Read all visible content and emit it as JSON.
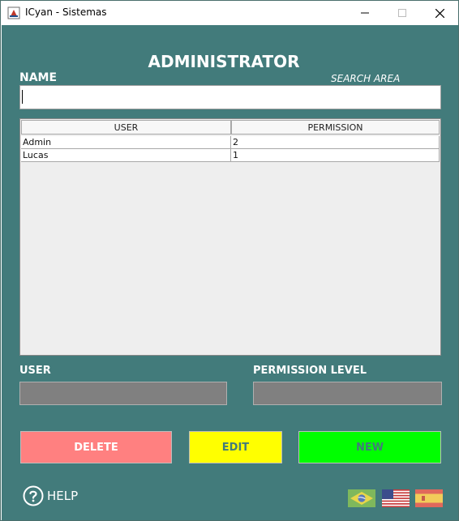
{
  "window": {
    "title": "ICyan - Sistemas"
  },
  "header": {
    "title": "ADMINISTRATOR",
    "name_label": "NAME",
    "search_hint": "SEARCH AREA"
  },
  "search": {
    "value": "",
    "placeholder": ""
  },
  "table": {
    "columns": [
      "USER",
      "PERMISSION"
    ],
    "rows": [
      [
        "Admin",
        "2"
      ],
      [
        "Lucas",
        "1"
      ]
    ]
  },
  "form": {
    "user_label": "USER",
    "permission_label": "PERMISSION LEVEL"
  },
  "buttons": {
    "delete": "DELETE",
    "edit": "EDIT",
    "new": "NEW"
  },
  "footer": {
    "help_label": "HELP",
    "flags": [
      "brazil-flag-icon",
      "usa-flag-icon",
      "spain-flag-icon"
    ]
  },
  "colors": {
    "background": "#427b7b",
    "delete": "#ff8080",
    "edit": "#ffff00",
    "new": "#00ff00",
    "field": "#808080"
  }
}
